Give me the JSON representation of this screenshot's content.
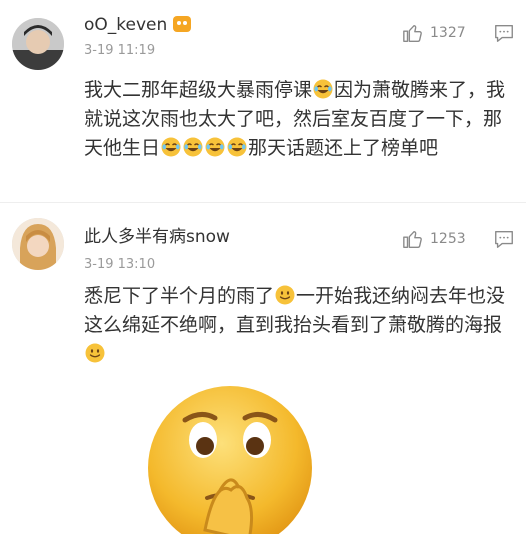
{
  "comments": [
    {
      "username": "oO_keven",
      "time": "3-19 11:19",
      "likes": "1327",
      "text": [
        {
          "t": "我大二那年超级大暴雨停课"
        },
        {
          "emoji": "laugh-cry"
        },
        {
          "t": "因为萧敬腾来了，我就说这次雨也太大了吧，然后室友百度了一下，那天他生日"
        },
        {
          "emoji": "laugh-cry"
        },
        {
          "emoji": "laugh-cry"
        },
        {
          "emoji": "laugh-cry"
        },
        {
          "emoji": "laugh-cry"
        },
        {
          "t": "那天话题还上了榜单吧"
        }
      ]
    },
    {
      "username": "此人多半有病snow",
      "time": "3-19 13:10",
      "likes": "1253",
      "text": [
        {
          "t": "悉尼下了半个月的雨了"
        },
        {
          "emoji": "smile"
        },
        {
          "t": "一开始我还纳闷去年也没这么绵延不绝啊，直到我抬头看到了萧敬腾的海报"
        },
        {
          "emoji": "smile"
        }
      ]
    }
  ],
  "icons": {
    "like": "thumbs-up-icon",
    "reply": "comment-icon",
    "vip": "vip-badge-icon",
    "sticker": "peeking-emoji-sticker"
  },
  "colors": {
    "text": "#333333",
    "meta": "#9a9a9a",
    "emoji": "#f7c23a"
  }
}
